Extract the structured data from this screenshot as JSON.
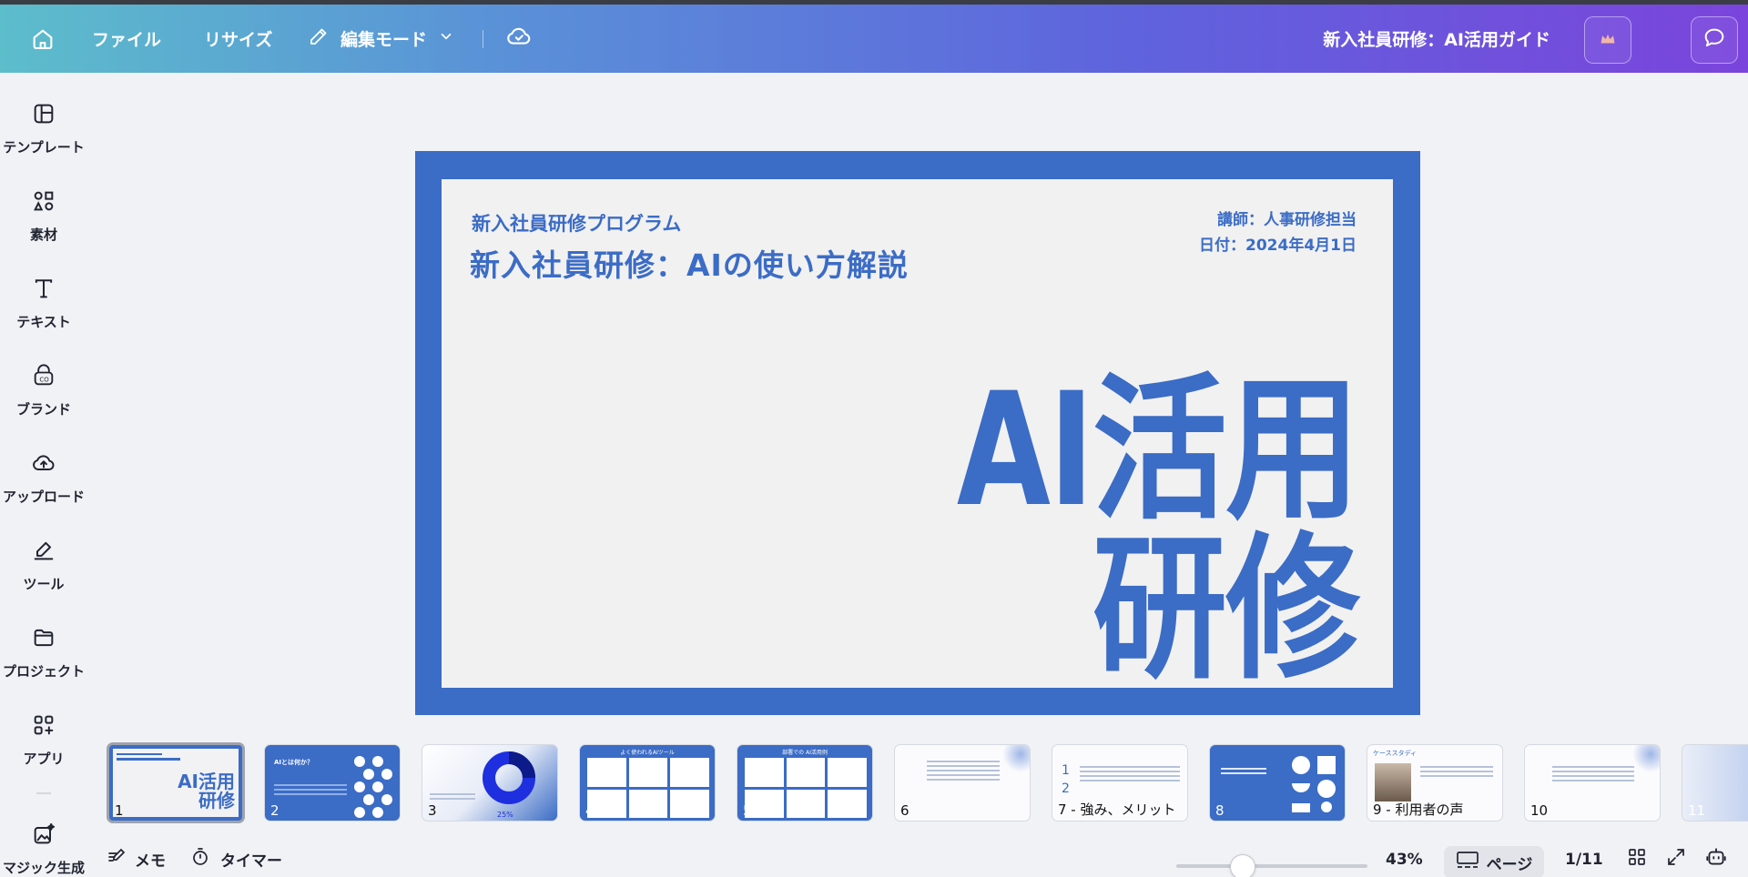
{
  "topbar": {
    "home_icon": "home-icon",
    "file_label": "ファイル",
    "resize_label": "リサイズ",
    "edit_mode_label": "編集モード",
    "doc_title": "新入社員研修：AI活用ガイド"
  },
  "sidebar": {
    "items": [
      {
        "label": "テンプレート",
        "icon": "template-icon"
      },
      {
        "label": "素材",
        "icon": "elements-icon"
      },
      {
        "label": "テキスト",
        "icon": "text-icon"
      },
      {
        "label": "ブランド",
        "icon": "brand-icon"
      },
      {
        "label": "アップロード",
        "icon": "upload-icon"
      },
      {
        "label": "ツール",
        "icon": "tools-icon"
      },
      {
        "label": "プロジェクト",
        "icon": "folder-icon"
      },
      {
        "label": "アプリ",
        "icon": "apps-icon"
      },
      {
        "label": "マジック生成",
        "icon": "magic-media-icon"
      }
    ]
  },
  "slide": {
    "subtitle": "新入社員研修プログラム",
    "title": "新入社員研修：AIの使い方解説",
    "instructor": "講師：人事研修担当",
    "date": "日付：2024年4月1日",
    "big_line1": "AI活用",
    "big_line2": "研修"
  },
  "thumbnails": [
    {
      "label": "1",
      "mini_text": "AI活用\n研修"
    },
    {
      "label": "2",
      "mini_text": "AIとは何か？"
    },
    {
      "label": "3",
      "mini_text": "25%"
    },
    {
      "label": "4",
      "mini_text": "よく使われるAIツール"
    },
    {
      "label": "5",
      "mini_text": "部署での AI活用例"
    },
    {
      "label": "6",
      "mini_text": ""
    },
    {
      "label": "7 - 強み、メリット",
      "mini_text": ""
    },
    {
      "label": "8",
      "mini_text": ""
    },
    {
      "label": "9 - 利用者の声",
      "mini_text": "ケーススタディ"
    },
    {
      "label": "10",
      "mini_text": ""
    },
    {
      "label": "11",
      "mini_text": ""
    }
  ],
  "bottombar": {
    "notes_label": "メモ",
    "timer_label": "タイマー",
    "zoom": "43%",
    "zoom_value": 43,
    "pages_label": "ページ",
    "page_indicator": "1/11"
  },
  "colors": {
    "slide_blue": "#3b6cc6",
    "slide_bg": "#f1f1f1"
  }
}
